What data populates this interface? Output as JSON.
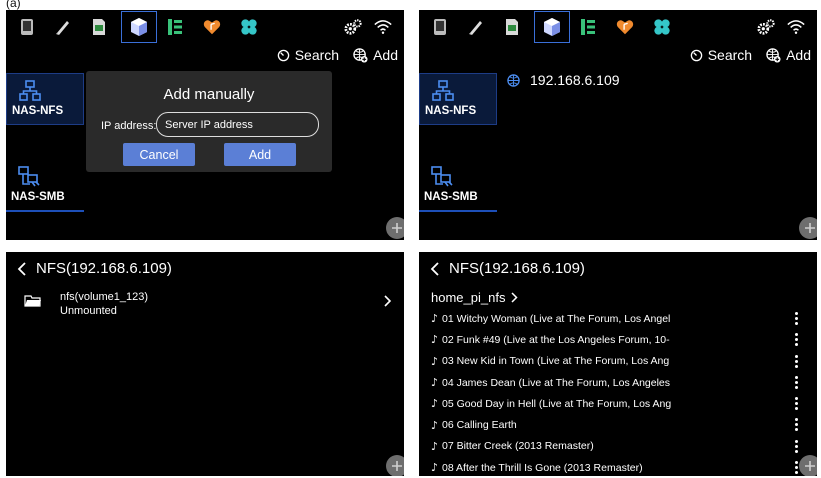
{
  "figure_label": "(a)",
  "actions": {
    "search_label": "Search",
    "add_label": "Add"
  },
  "nav": {
    "nfs_label": "NAS-NFS",
    "smb_label": "NAS-SMB"
  },
  "dialog": {
    "title": "Add manually",
    "ip_label": "IP address:",
    "ip_placeholder": "Server IP address",
    "cancel_label": "Cancel",
    "add_label": "Add"
  },
  "server": {
    "ip": "192.168.6.109"
  },
  "browser": {
    "header_title": "NFS(192.168.6.109)",
    "share_name": "nfs(volume1_123)",
    "share_status": "Unmounted",
    "breadcrumb": "home_pi_nfs",
    "tracks": [
      "01 Witchy Woman (Live at The Forum, Los Angel",
      "02 Funk #49 (Live at the Los Angeles Forum, 10-",
      "03 New Kid in Town (Live at The Forum, Los Ang",
      "04 James Dean (Live at The Forum, Los Angeles",
      "05 Good Day in Hell (Live at The Forum, Los Ang",
      "06 Calling Earth",
      "07 Bitter Creek (2013 Remaster)",
      "08 After the Thrill Is Gone (2013 Remaster)"
    ]
  },
  "icons": [
    "phone-icon",
    "pencil-icon",
    "sd-card-icon",
    "cube-icon",
    "list-icon",
    "heart-music-icon",
    "clover-icon",
    "gears-icon",
    "wifi-icon",
    "timer-icon",
    "globe-icon",
    "network-icon",
    "plus-icon",
    "back-chevron-icon",
    "folder-icon",
    "chevron-right-icon",
    "music-note-icon",
    "more-vertical-icon"
  ],
  "colors": {
    "accent": "#5b7fd6",
    "selection": "#3a6fd8",
    "panel_bg": "#000000",
    "dialog_bg": "#2a2a2a"
  }
}
